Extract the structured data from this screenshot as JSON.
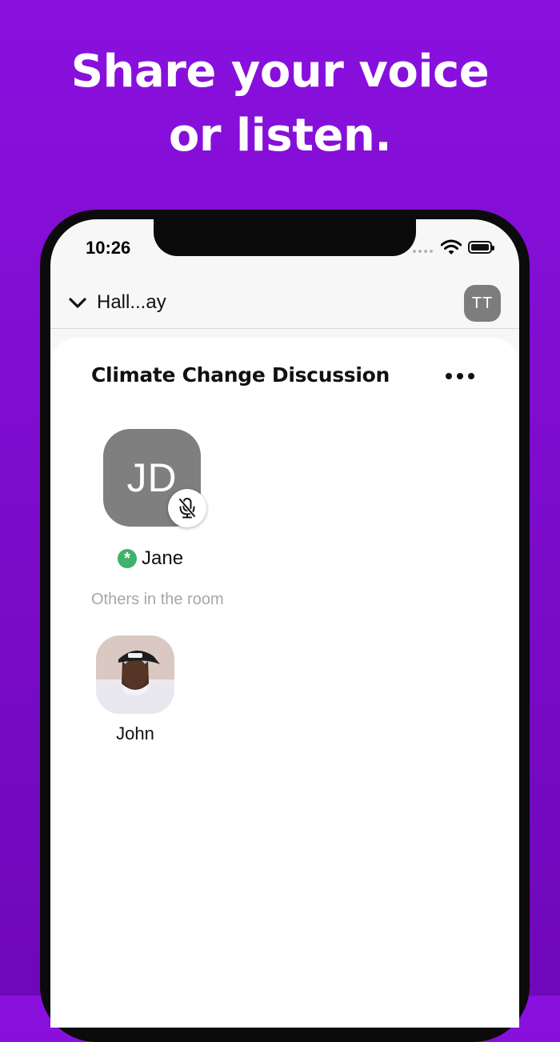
{
  "headline": {
    "line1": "Share your voice",
    "line2": "or listen."
  },
  "status_bar": {
    "time": "10:26"
  },
  "nav": {
    "title": "Hall...ay",
    "avatar_initials": "TT"
  },
  "room": {
    "title": "Climate Change Discussion",
    "speaker": {
      "initials": "JD",
      "name": "Jane",
      "moderator_badge": "*"
    },
    "others_label": "Others in the room",
    "listeners": [
      {
        "name": "John"
      }
    ]
  },
  "colors": {
    "background": "#8a10de",
    "avatar_gray": "#7f7f7f",
    "moderator_green": "#3fb26b"
  }
}
